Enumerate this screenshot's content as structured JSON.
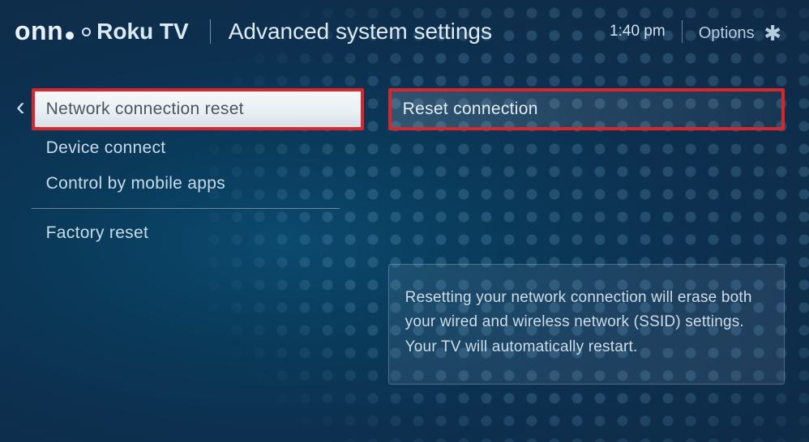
{
  "header": {
    "brand_onn": "onn",
    "brand_roku": "Roku TV",
    "page_title": "Advanced system settings",
    "clock": "1:40 pm",
    "options_label": "Options"
  },
  "menu": {
    "items": [
      {
        "label": "Network connection reset",
        "selected": true
      },
      {
        "label": "Device connect",
        "selected": false
      },
      {
        "label": "Control by mobile apps",
        "selected": false
      },
      {
        "label": "Factory reset",
        "selected": false
      }
    ]
  },
  "submenu": {
    "label": "Reset connection"
  },
  "info": {
    "text": "Resetting your network connection will erase both your wired and wireless network (SSID) settings. Your TV will automatically restart."
  }
}
